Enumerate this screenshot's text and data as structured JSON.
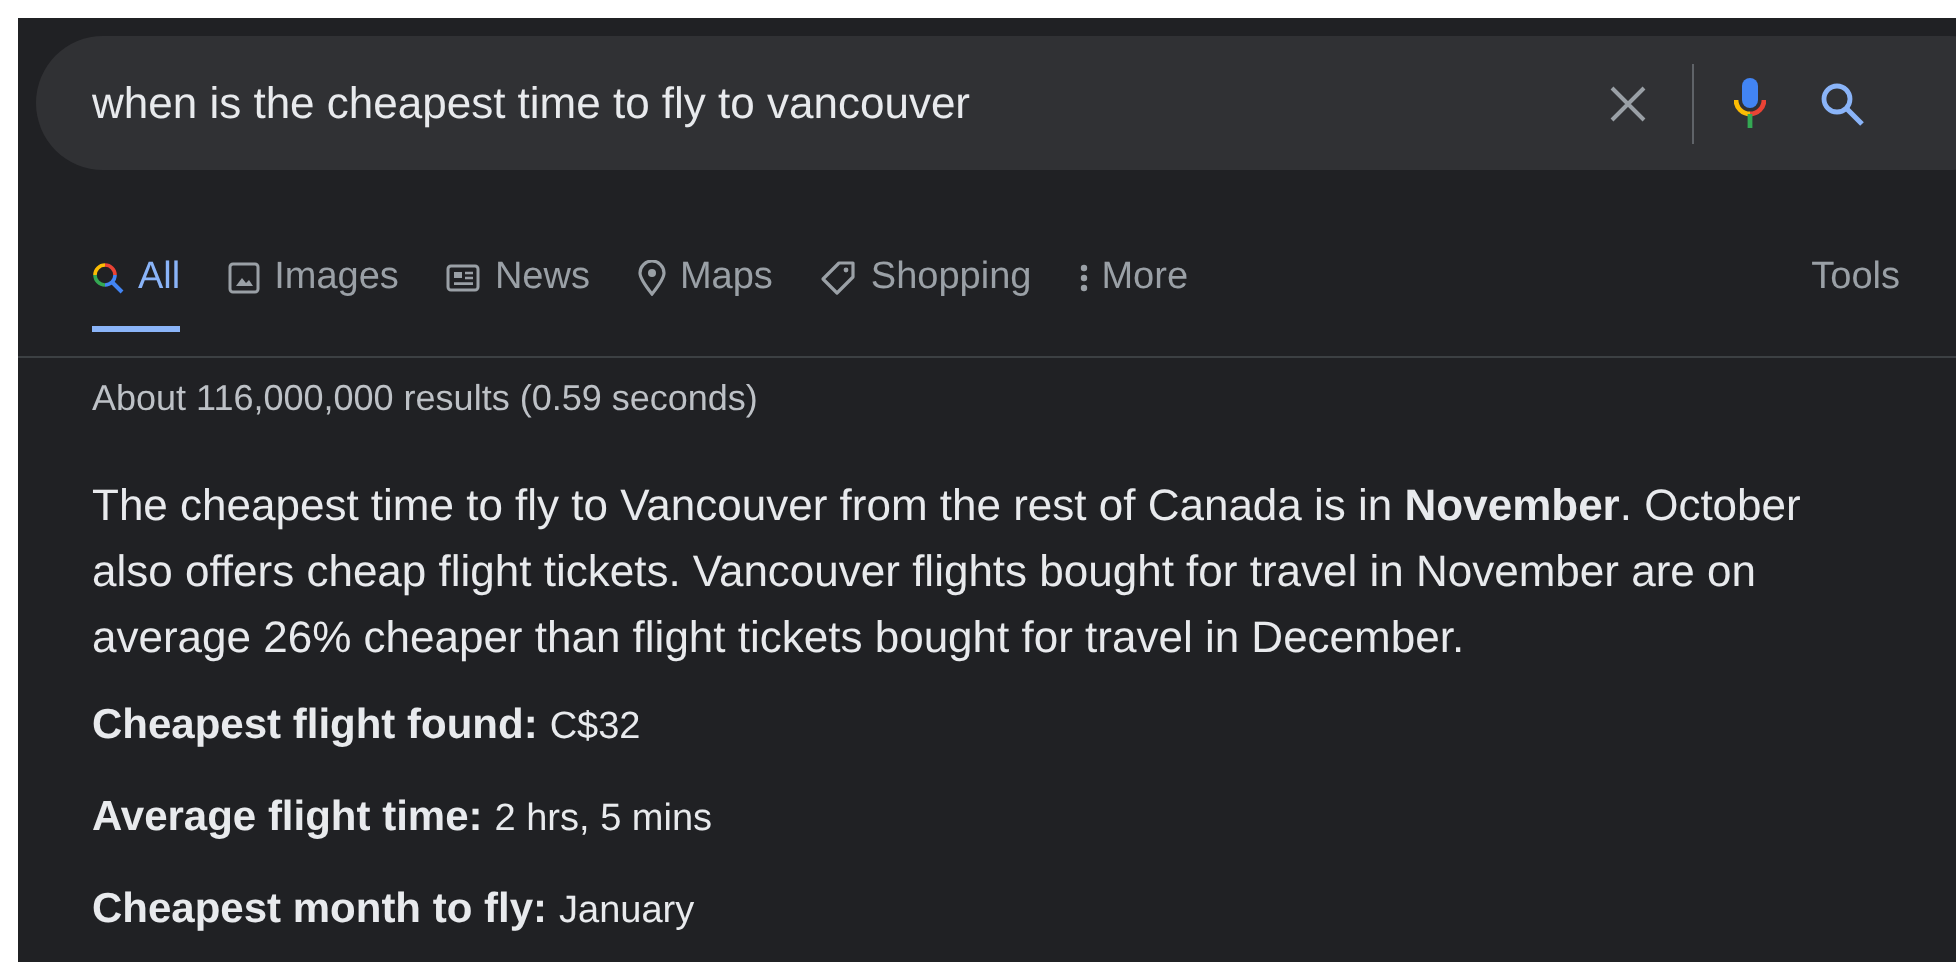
{
  "search": {
    "value": "when is the cheapest time to fly to vancouver"
  },
  "tabs": [
    {
      "label": "All",
      "kind": "all",
      "selected": true
    },
    {
      "label": "Images",
      "kind": "images",
      "selected": false
    },
    {
      "label": "News",
      "kind": "news",
      "selected": false
    },
    {
      "label": "Maps",
      "kind": "maps",
      "selected": false
    },
    {
      "label": "Shopping",
      "kind": "shopping",
      "selected": false
    },
    {
      "label": "More",
      "kind": "more",
      "selected": false
    }
  ],
  "tools": "Tools",
  "result_stats": "About 116,000,000 results (0.59 seconds)",
  "snippet": "The cheapest time to fly to Vancouver from the rest of Canada is in **November**. October also offers cheap flight tickets. Vancouver flights bought for travel in November are on average 26% cheaper than flight tickets bought for travel in December.",
  "facts": [
    {
      "label": "Cheapest flight found:",
      "value": "C$32"
    },
    {
      "label": "Average flight time:",
      "value": "2 hrs, 5 mins"
    },
    {
      "label": "Cheapest month to fly:",
      "value": "January"
    }
  ]
}
